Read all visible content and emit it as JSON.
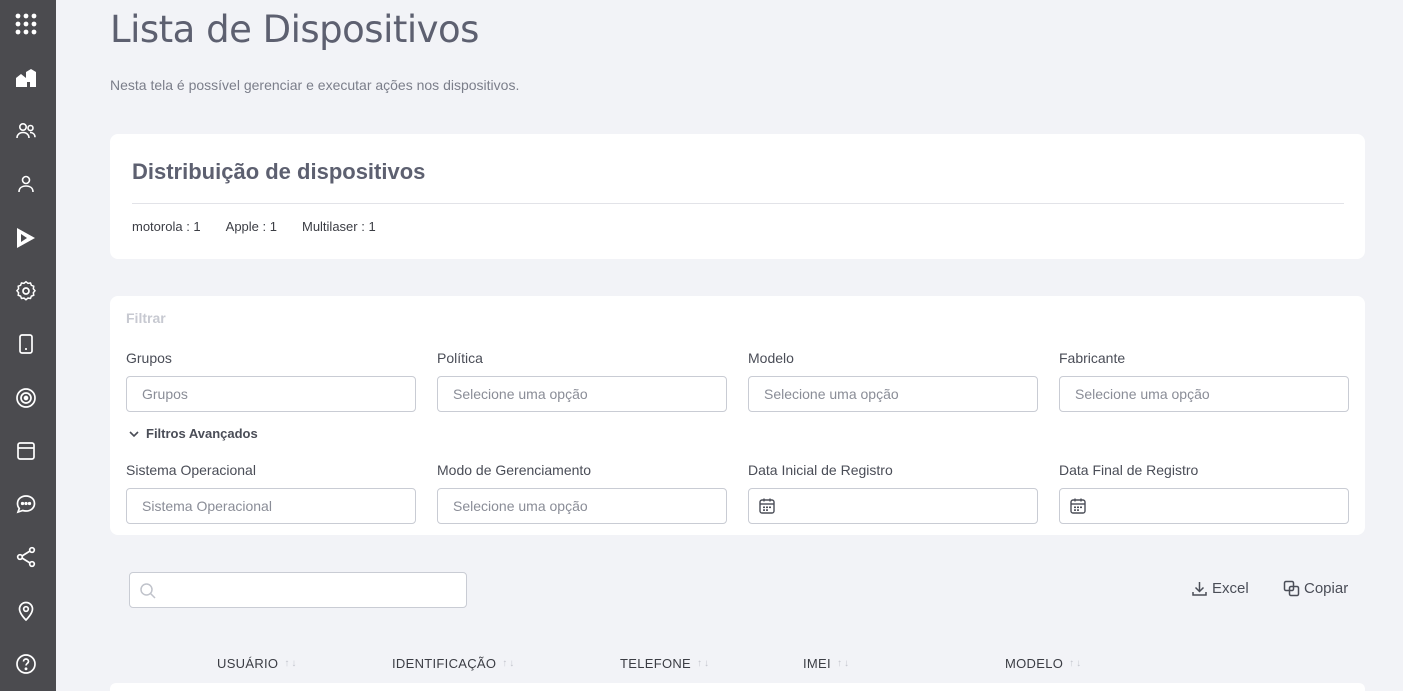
{
  "sidebar": {
    "icons": [
      "apps-grid-icon",
      "home-icon",
      "users-icon",
      "user-icon",
      "play-store-icon",
      "settings-icon",
      "device-icon",
      "target-icon",
      "window-icon",
      "chat-icon",
      "share-icon",
      "location-icon",
      "help-icon"
    ]
  },
  "page": {
    "title": "Lista de Dispositivos",
    "subtitle": "Nesta tela é possível gerenciar e executar ações nos dispositivos."
  },
  "distribution": {
    "title": "Distribuição de dispositivos",
    "items": [
      "motorola : 1",
      "Apple : 1",
      "Multilaser : 1"
    ]
  },
  "filter": {
    "title": "Filtrar",
    "fields": [
      {
        "label": "Grupos",
        "placeholder": "Grupos"
      },
      {
        "label": "Política",
        "placeholder": "Selecione uma opção"
      },
      {
        "label": "Modelo",
        "placeholder": "Selecione uma opção"
      },
      {
        "label": "Fabricante",
        "placeholder": "Selecione uma opção"
      }
    ],
    "advanced_label": "Filtros Avançados",
    "advanced_fields": [
      {
        "label": "Sistema Operacional",
        "placeholder": "Sistema Operacional"
      },
      {
        "label": "Modo de Gerenciamento",
        "placeholder": "Selecione uma opção"
      },
      {
        "label": "Data Inicial de Registro",
        "placeholder": ""
      },
      {
        "label": "Data Final de Registro",
        "placeholder": ""
      }
    ]
  },
  "toolbar": {
    "search_placeholder": "",
    "excel_label": "Excel",
    "copy_label": "Copiar"
  },
  "table": {
    "columns": [
      "USUÁRIO",
      "IDENTIFICAÇÃO",
      "TELEFONE",
      "IMEI",
      "MODELO"
    ]
  },
  "colors": {
    "sidebar_bg": "#4b4b4f",
    "page_bg": "#f2f3f7",
    "card_bg": "#ffffff"
  }
}
